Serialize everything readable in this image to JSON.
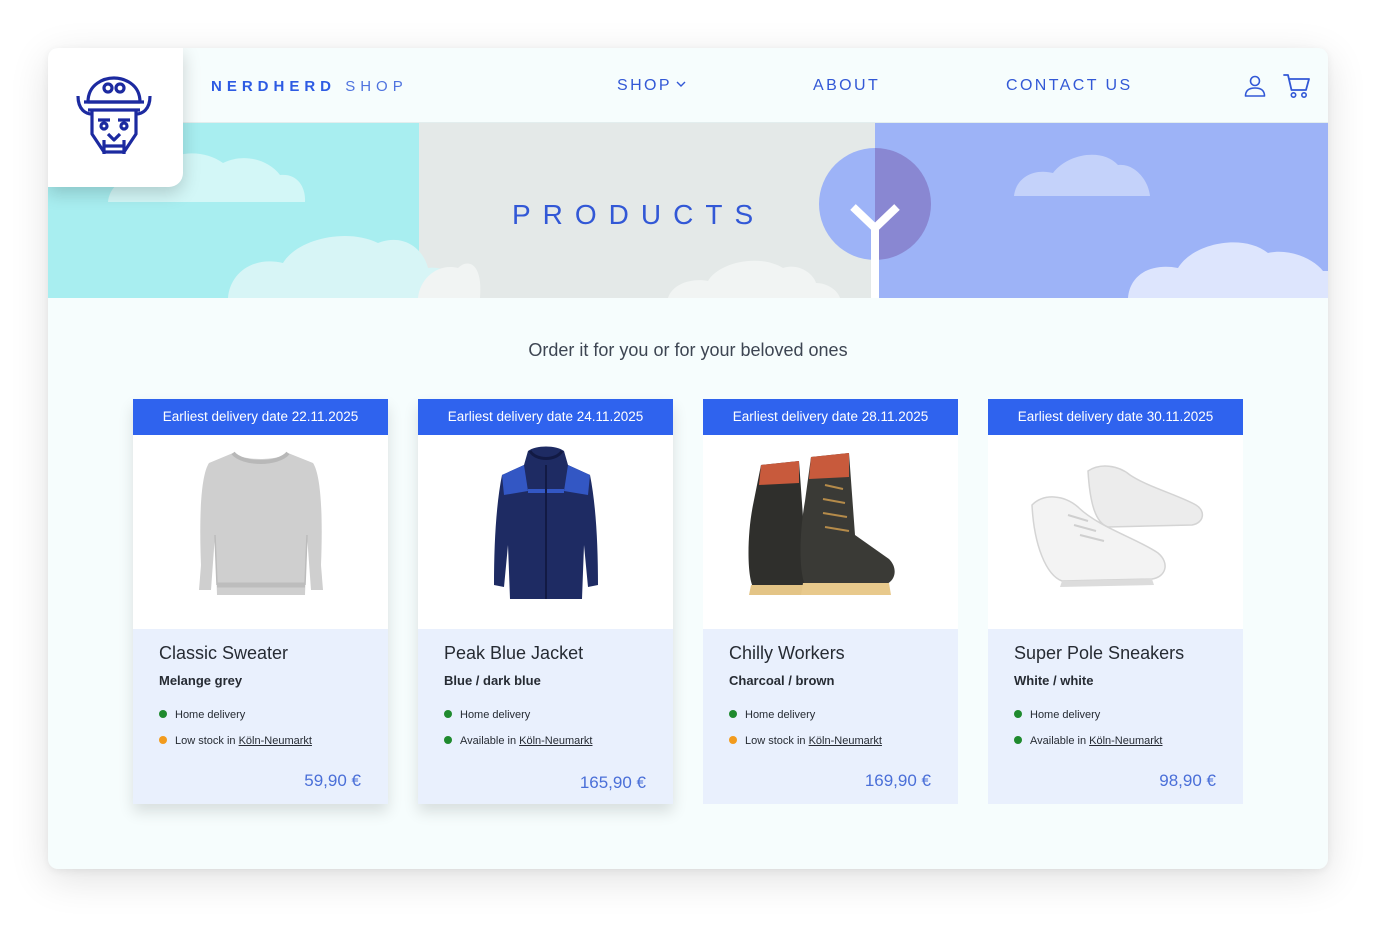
{
  "header": {
    "brand_primary": "NERDHERD",
    "brand_secondary": "SHOP",
    "nav": [
      {
        "label": "SHOP",
        "has_dropdown": true
      },
      {
        "label": "ABOUT"
      },
      {
        "label": "CONTACT US"
      }
    ],
    "icons": [
      "user-icon",
      "cart-icon",
      "chevron-down-icon"
    ]
  },
  "banner": {
    "title": "PRODUCTS"
  },
  "tagline": "Order it for you or for your beloved ones",
  "products": [
    {
      "delivery": "Earliest delivery date 22.11.2025",
      "name": "Classic Sweater",
      "variant": "Melange grey",
      "home_delivery": "Home delivery",
      "home_delivery_color": "#1f8a2e",
      "stock_text": "Low stock in ",
      "stock_location": "Köln-Neumarkt",
      "stock_color": "#f29b1d",
      "price": "59,90 €",
      "image": "grey-sweater"
    },
    {
      "delivery": "Earliest delivery date 24.11.2025",
      "name": "Peak Blue Jacket",
      "variant": "Blue / dark blue",
      "home_delivery": "Home delivery",
      "home_delivery_color": "#1f8a2e",
      "stock_text": "Available in ",
      "stock_location": "Köln-Neumarkt",
      "stock_color": "#1f8a2e",
      "price": "165,90 €",
      "image": "blue-jacket"
    },
    {
      "delivery": "Earliest delivery date 28.11.2025",
      "name": "Chilly Workers",
      "variant": "Charcoal / brown",
      "home_delivery": "Home delivery",
      "home_delivery_color": "#1f8a2e",
      "stock_text": "Low stock in ",
      "stock_location": "Köln-Neumarkt",
      "stock_color": "#f29b1d",
      "price": "169,90 €",
      "image": "work-boots"
    },
    {
      "delivery": "Earliest delivery date 30.11.2025",
      "name": "Super Pole Sneakers",
      "variant": "White / white",
      "home_delivery": "Home delivery",
      "home_delivery_color": "#1f8a2e",
      "stock_text": "Available in ",
      "stock_location": "Köln-Neumarkt",
      "stock_color": "#1f8a2e",
      "price": "98,90 €",
      "image": "white-sneakers"
    }
  ],
  "colors": {
    "accent": "#2f63ee",
    "nav_text": "#3258d6",
    "card_bg": "#e9f0fd",
    "banner_cyan": "#a8eef0",
    "banner_grey": "#e4e9e8",
    "banner_blue": "#9db3f7"
  }
}
